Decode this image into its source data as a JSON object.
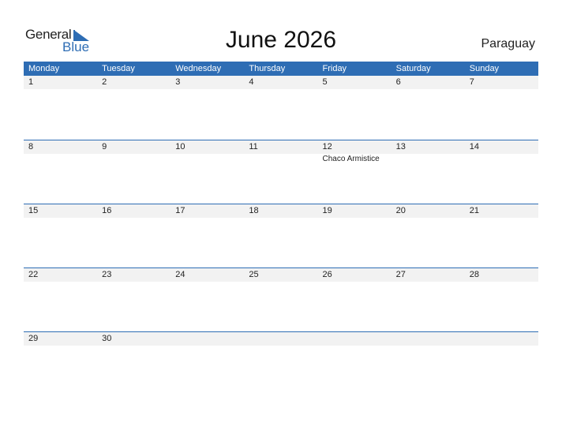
{
  "logo": {
    "general": "General",
    "blue": "Blue",
    "brand_color": "#2e6db4"
  },
  "title": "June 2026",
  "country": "Paraguay",
  "weekdays": [
    "Monday",
    "Tuesday",
    "Wednesday",
    "Thursday",
    "Friday",
    "Saturday",
    "Sunday"
  ],
  "weeks": [
    {
      "days": [
        "1",
        "2",
        "3",
        "4",
        "5",
        "6",
        "7"
      ],
      "events": [
        "",
        "",
        "",
        "",
        "",
        "",
        ""
      ]
    },
    {
      "days": [
        "8",
        "9",
        "10",
        "11",
        "12",
        "13",
        "14"
      ],
      "events": [
        "",
        "",
        "",
        "",
        "Chaco Armistice",
        "",
        ""
      ]
    },
    {
      "days": [
        "15",
        "16",
        "17",
        "18",
        "19",
        "20",
        "21"
      ],
      "events": [
        "",
        "",
        "",
        "",
        "",
        "",
        ""
      ]
    },
    {
      "days": [
        "22",
        "23",
        "24",
        "25",
        "26",
        "27",
        "28"
      ],
      "events": [
        "",
        "",
        "",
        "",
        "",
        "",
        ""
      ]
    },
    {
      "days": [
        "29",
        "30",
        "",
        "",
        "",
        "",
        ""
      ],
      "events": [
        "",
        "",
        "",
        "",
        "",
        "",
        ""
      ]
    }
  ]
}
